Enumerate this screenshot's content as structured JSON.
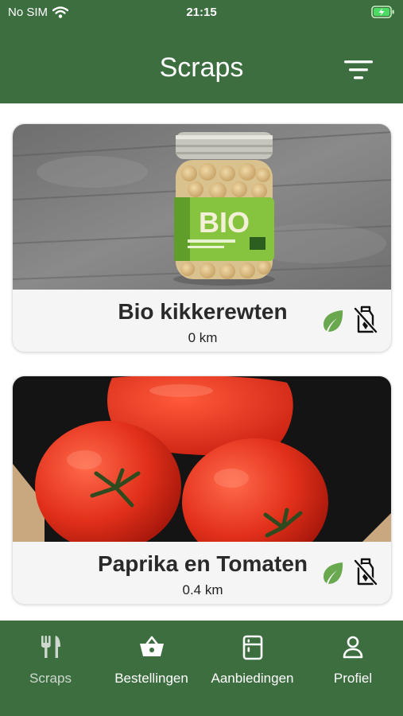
{
  "status_bar": {
    "carrier": "No SIM",
    "time": "21:15"
  },
  "header": {
    "title": "Scraps"
  },
  "items": [
    {
      "name": "Bio kikkerewten",
      "distance": "0 km",
      "jar_label": "BIO",
      "icons": [
        "leaf-icon",
        "no-milk-icon"
      ]
    },
    {
      "name": "Paprika en Tomaten",
      "distance": "0.4 km",
      "icons": [
        "leaf-icon",
        "no-milk-icon"
      ]
    }
  ],
  "tabs": [
    {
      "label": "Scraps",
      "icon": "fork-knife-icon",
      "active": true
    },
    {
      "label": "Bestellingen",
      "icon": "basket-icon",
      "active": false
    },
    {
      "label": "Aanbiedingen",
      "icon": "fridge-icon",
      "active": false
    },
    {
      "label": "Profiel",
      "icon": "person-icon",
      "active": false
    }
  ],
  "colors": {
    "brand_green": "#3c6e3f",
    "leaf_green": "#6aa84f"
  }
}
